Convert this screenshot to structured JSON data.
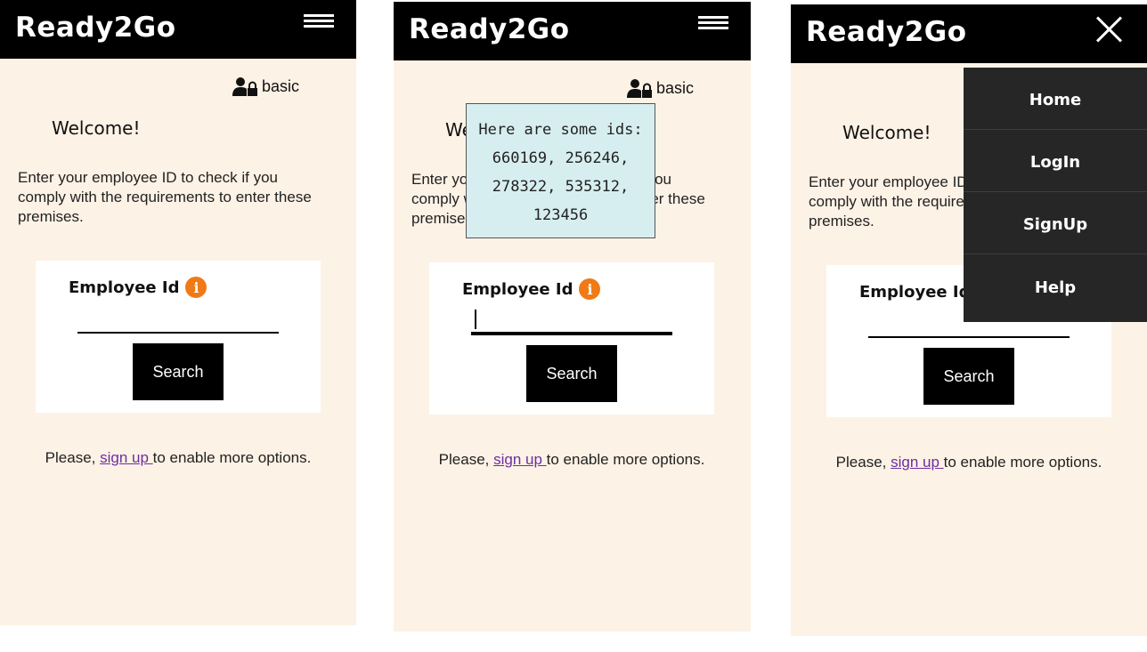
{
  "app": {
    "brand": "Ready2Go",
    "user_role": "basic",
    "welcome": "Welcome!",
    "instructions": "Enter your employee ID to check if you comply with the requirements to enter these premises.",
    "employee_id_label": "Employee Id",
    "info_glyph": "i",
    "employee_id_value": "",
    "search_label": "Search",
    "signup_prefix": "Please, ",
    "signup_link": "sign up ",
    "signup_suffix": "to enable more options."
  },
  "screens": [
    {
      "state": "default",
      "header_icon": "hamburger-icon"
    },
    {
      "state": "info-tooltip-open",
      "header_icon": "hamburger-icon"
    },
    {
      "state": "menu-open",
      "header_icon": "close-icon"
    }
  ],
  "tooltip": {
    "text": "Here are some ids: 660169, 256246, 278322, 535312, 123456"
  },
  "menu": {
    "items": [
      "Home",
      "LogIn",
      "SignUp",
      "Help"
    ]
  },
  "colors": {
    "header_bg": "#000000",
    "page_bg": "#fdf2e6",
    "info_icon": "#f07a16",
    "tooltip_bg": "#d7eef0",
    "menu_bg": "#262626",
    "link": "#6b2fa0"
  }
}
